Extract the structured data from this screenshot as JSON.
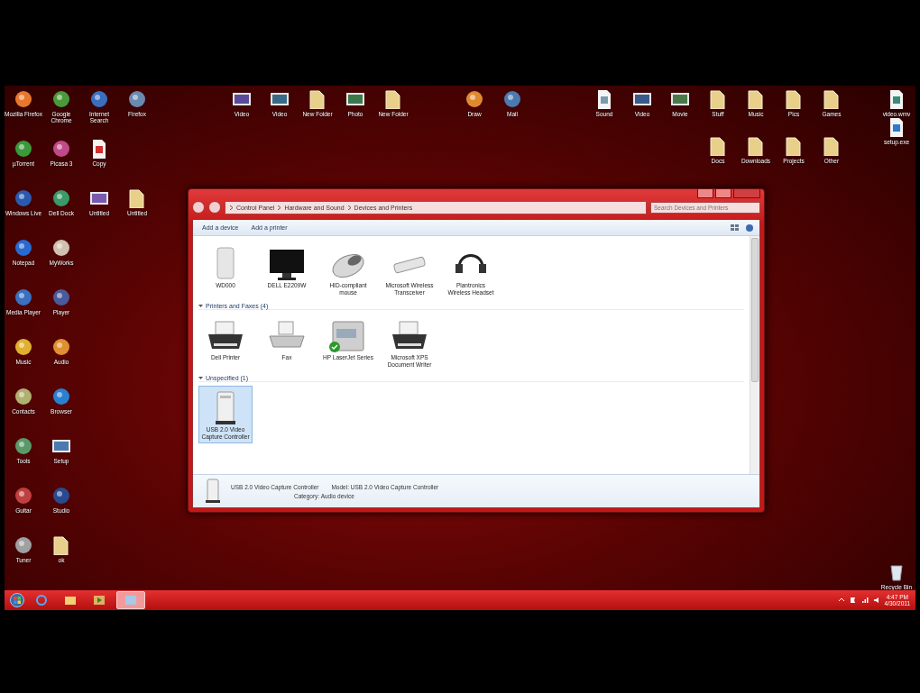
{
  "desktop": {
    "left_rows": [
      [
        {
          "label": "Mozilla Firefox",
          "kind": "app",
          "color": "#e8772e"
        },
        {
          "label": "Google Chrome",
          "kind": "app",
          "color": "#4a9a3a"
        },
        {
          "label": "Internet Search",
          "kind": "app",
          "color": "#3a6fc0"
        },
        {
          "label": "Firefox",
          "kind": "app",
          "color": "#6a8ab0"
        }
      ],
      [
        {
          "label": "µTorrent",
          "kind": "app",
          "color": "#3a9a3a"
        },
        {
          "label": "Picasa 3",
          "kind": "app",
          "color": "#c04a8a"
        },
        {
          "label": "Copy",
          "kind": "doc",
          "color": "#d03030"
        }
      ],
      [
        {
          "label": "Windows Live",
          "kind": "app",
          "color": "#2a5ab0"
        },
        {
          "label": "Dell Dock",
          "kind": "app",
          "color": "#3a9a6a"
        },
        {
          "label": "Untitled",
          "kind": "image",
          "color": "#7a5ab0"
        },
        {
          "label": "Untitled",
          "kind": "folder",
          "color": "#e8d08a"
        }
      ],
      [
        {
          "label": "Notepad",
          "kind": "app",
          "color": "#2a6ad0"
        },
        {
          "label": "MyWorks",
          "kind": "app",
          "color": "#d0c0b0"
        }
      ],
      [
        {
          "label": "Media Player",
          "kind": "app",
          "color": "#3a70c0"
        },
        {
          "label": "Player",
          "kind": "app",
          "color": "#4a5a9a"
        }
      ],
      [
        {
          "label": "Music",
          "kind": "app",
          "color": "#e0b030"
        },
        {
          "label": "Audio",
          "kind": "app",
          "color": "#e09030"
        }
      ],
      [
        {
          "label": "Contacts",
          "kind": "app",
          "color": "#b0b070"
        },
        {
          "label": "Browser",
          "kind": "app",
          "color": "#2a80d0"
        }
      ],
      [
        {
          "label": "Tools",
          "kind": "app",
          "color": "#5a9a6a"
        },
        {
          "label": "Setup",
          "kind": "image",
          "color": "#4a7ab0"
        }
      ],
      [
        {
          "label": "Guitar",
          "kind": "app",
          "color": "#c04040"
        },
        {
          "label": "Studio",
          "kind": "app",
          "color": "#2a4a90"
        }
      ],
      [
        {
          "label": "Tuner",
          "kind": "app",
          "color": "#a0a0a0"
        },
        {
          "label": "ok",
          "kind": "folder",
          "color": "#e8d08a"
        }
      ]
    ],
    "top_groups": [
      [
        [
          {
            "label": "Video",
            "kind": "image",
            "color": "#5a4a9a"
          },
          {
            "label": "Video",
            "kind": "image",
            "color": "#3a6a8a"
          },
          {
            "label": "New Folder",
            "kind": "folder",
            "color": "#e8d08a"
          },
          {
            "label": "Photo",
            "kind": "image",
            "color": "#3a7a4a"
          },
          {
            "label": "New Folder",
            "kind": "folder",
            "color": "#e8d08a"
          }
        ]
      ],
      [
        [
          {
            "label": "Draw",
            "kind": "app",
            "color": "#e08a30"
          },
          {
            "label": "Mail",
            "kind": "app",
            "color": "#4a7ab0"
          }
        ]
      ],
      [
        [
          {
            "label": "Sound",
            "kind": "doc",
            "color": "#7a9ab0"
          },
          {
            "label": "Video",
            "kind": "image",
            "color": "#3a5a8a"
          },
          {
            "label": "Movie",
            "kind": "image",
            "color": "#4a7a4a"
          },
          {
            "label": "Stuff",
            "kind": "folder",
            "color": "#e8d08a"
          },
          {
            "label": "Music",
            "kind": "folder",
            "color": "#e8d08a"
          },
          {
            "label": "Pics",
            "kind": "folder",
            "color": "#e8d08a"
          },
          {
            "label": "Games",
            "kind": "folder",
            "color": "#e8d08a"
          }
        ],
        [
          {
            "label": "Docs",
            "kind": "folder",
            "color": "#e8d08a"
          },
          {
            "label": "Downloads",
            "kind": "folder",
            "color": "#e8d08a"
          },
          {
            "label": "Projects",
            "kind": "folder",
            "color": "#e8d08a"
          },
          {
            "label": "Other",
            "kind": "folder",
            "color": "#e8d08a"
          }
        ]
      ]
    ],
    "right_icons": [
      {
        "label": "video.wmv",
        "kind": "doc",
        "color": "#3a8a7a"
      },
      {
        "label": "setup.exe",
        "kind": "doc",
        "color": "#2a7ad0"
      }
    ],
    "recycle_bin": {
      "label": "Recycle Bin"
    }
  },
  "window": {
    "breadcrumbs": [
      "Control Panel",
      "Hardware and Sound",
      "Devices and Printers"
    ],
    "search": {
      "placeholder": "Search Devices and Printers"
    },
    "toolbar": [
      "Add a device",
      "Add a printer"
    ],
    "sections": [
      {
        "items": [
          {
            "label": "WD000",
            "kind": "drive",
            "selected": false,
            "default": false
          },
          {
            "label": "DELL E2209W",
            "kind": "monitor",
            "selected": false,
            "default": false
          },
          {
            "label": "HID-compliant mouse",
            "kind": "mouse",
            "selected": false,
            "default": false
          },
          {
            "label": "Microsoft Wireless Transceiver",
            "kind": "usb",
            "selected": false,
            "default": false
          },
          {
            "label": "Plantronics Wireless Headset",
            "kind": "headset",
            "selected": false,
            "default": false
          }
        ]
      },
      {
        "title": "Printers and Faxes (4)",
        "items": [
          {
            "label": "Dell Printer",
            "kind": "printer",
            "selected": false,
            "default": false
          },
          {
            "label": "Fax",
            "kind": "fax",
            "selected": false,
            "default": false
          },
          {
            "label": "HP LaserJet Series",
            "kind": "mfp",
            "selected": false,
            "default": true
          },
          {
            "label": "Microsoft XPS Document Writer",
            "kind": "printer",
            "selected": false,
            "default": false
          }
        ]
      },
      {
        "title": "Unspecified (1)",
        "items": [
          {
            "label": "USB 2.0 Video Capture Controller",
            "kind": "tower",
            "selected": true,
            "default": false
          }
        ]
      }
    ],
    "details": {
      "name": "USB 2.0 Video Capture Controller",
      "model": "Model: USB 2.0 Video Capture Controller",
      "category": "Category: Audio device"
    }
  },
  "taskbar": {
    "buttons": [
      {
        "kind": "ie",
        "active": false
      },
      {
        "kind": "explorer",
        "active": false
      },
      {
        "kind": "media",
        "active": false
      },
      {
        "kind": "control-panel",
        "active": true
      }
    ],
    "time": "4:47 PM",
    "date": "4/30/2011"
  }
}
